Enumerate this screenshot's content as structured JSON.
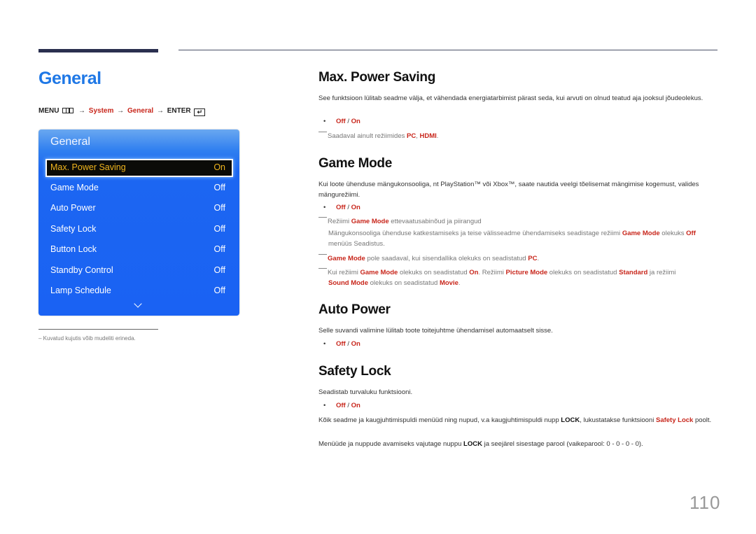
{
  "page": {
    "title": "General",
    "page_number": "110"
  },
  "menu_path": {
    "menu": "MENU",
    "menu_icon": "menu-icon",
    "arrow": "→",
    "system": "System",
    "general": "General",
    "enter": "ENTER",
    "enter_icon": "enter-icon"
  },
  "osd": {
    "title": "General",
    "items": [
      {
        "label": "Max. Power Saving",
        "value": "On",
        "selected": true
      },
      {
        "label": "Game Mode",
        "value": "Off"
      },
      {
        "label": "Auto Power",
        "value": "Off"
      },
      {
        "label": "Safety Lock",
        "value": "Off"
      },
      {
        "label": "Button Lock",
        "value": "Off"
      },
      {
        "label": "Standby Control",
        "value": "Off"
      },
      {
        "label": "Lamp Schedule",
        "value": "Off"
      }
    ],
    "more_icon": "chevron-down-icon",
    "colors": {
      "panel": "#1a62f3",
      "selected_bg": "#0b0b08",
      "selected_text": "#f0b51e"
    }
  },
  "footnote": "Kuvatud kujutis võib mudeliti erineda.",
  "sections": {
    "max_power_saving": {
      "heading": "Max. Power Saving",
      "body": "See funktsioon lülitab seadme välja, et vähendada energiatarbimist pärast seda, kui arvuti on olnud teatud aja jooksul jõudeolekus.",
      "option_off": "Off",
      "option_sep": " / ",
      "option_on": "On",
      "note_prefix": "Saadaval ainult režiimides ",
      "note_pc": "PC",
      "note_comma": ", ",
      "note_hdmi": "HDMI",
      "note_end": "."
    },
    "game_mode": {
      "heading": "Game Mode",
      "body": "Kui loote ühenduse mängukonsooliga, nt PlayStation™ või Xbox™, saate nautida veelgi tõelisemat mängimise kogemust, valides mängurežiimi.",
      "option_off": "Off",
      "option_sep": " / ",
      "option_on": "On",
      "note1_a": "Režiimi ",
      "note1_b": "Game Mode",
      "note1_c": " ettevaatusabinõud ja piirangud",
      "note1_sub_a": "Mängukonsooliga ühenduse katkestamiseks ja teise välisseadme ühendamiseks seadistage režiimi ",
      "note1_sub_b": "Game Mode",
      "note1_sub_c": " olekuks ",
      "note1_sub_d": "Off",
      "note1_sub_e": " menüüs Seadistus.",
      "note2_a": "Game Mode",
      "note2_b": " pole saadaval, kui sisendallika olekuks on seadistatud ",
      "note2_c": "PC",
      "note2_d": ".",
      "note3_a": "Kui režiimi ",
      "note3_b": "Game Mode",
      "note3_c": " olekuks on seadistatud ",
      "note3_d": "On",
      "note3_e": ". Režiimi ",
      "note3_f": "Picture Mode",
      "note3_g": " olekuks on seadistatud ",
      "note3_h": "Standard",
      "note3_i": " ja režiimi ",
      "note3_j": "Sound Mode",
      "note3_k": " olekuks on seadistatud ",
      "note3_l": "Movie",
      "note3_m": "."
    },
    "auto_power": {
      "heading": "Auto Power",
      "body": "Selle suvandi valimine lülitab toote toitejuhtme ühendamisel automaatselt sisse.",
      "option_off": "Off",
      "option_sep": " / ",
      "option_on": "On"
    },
    "safety_lock": {
      "heading": "Safety Lock",
      "body": "Seadistab turvaluku funktsiooni.",
      "option_off": "Off",
      "option_sep": " / ",
      "option_on": "On",
      "p2_a": "Kõik seadme ja kaugjuhtimispuldi menüüd ning nupud, v.a kaugjuhtimispuldi nupp ",
      "p2_b": "LOCK",
      "p2_c": ", lukustatakse funktsiooni ",
      "p2_d": "Safety Lock",
      "p2_e": " poolt.",
      "p3_a": "Menüüde ja nuppude avamiseks vajutage nuppu ",
      "p3_b": "LOCK",
      "p3_c": " ja seejärel sisestage parool (vaikeparool: 0 - 0 - 0 - 0)."
    }
  },
  "colors": {
    "accent_blue": "#1f78e6",
    "highlight_red": "#c8261b"
  }
}
